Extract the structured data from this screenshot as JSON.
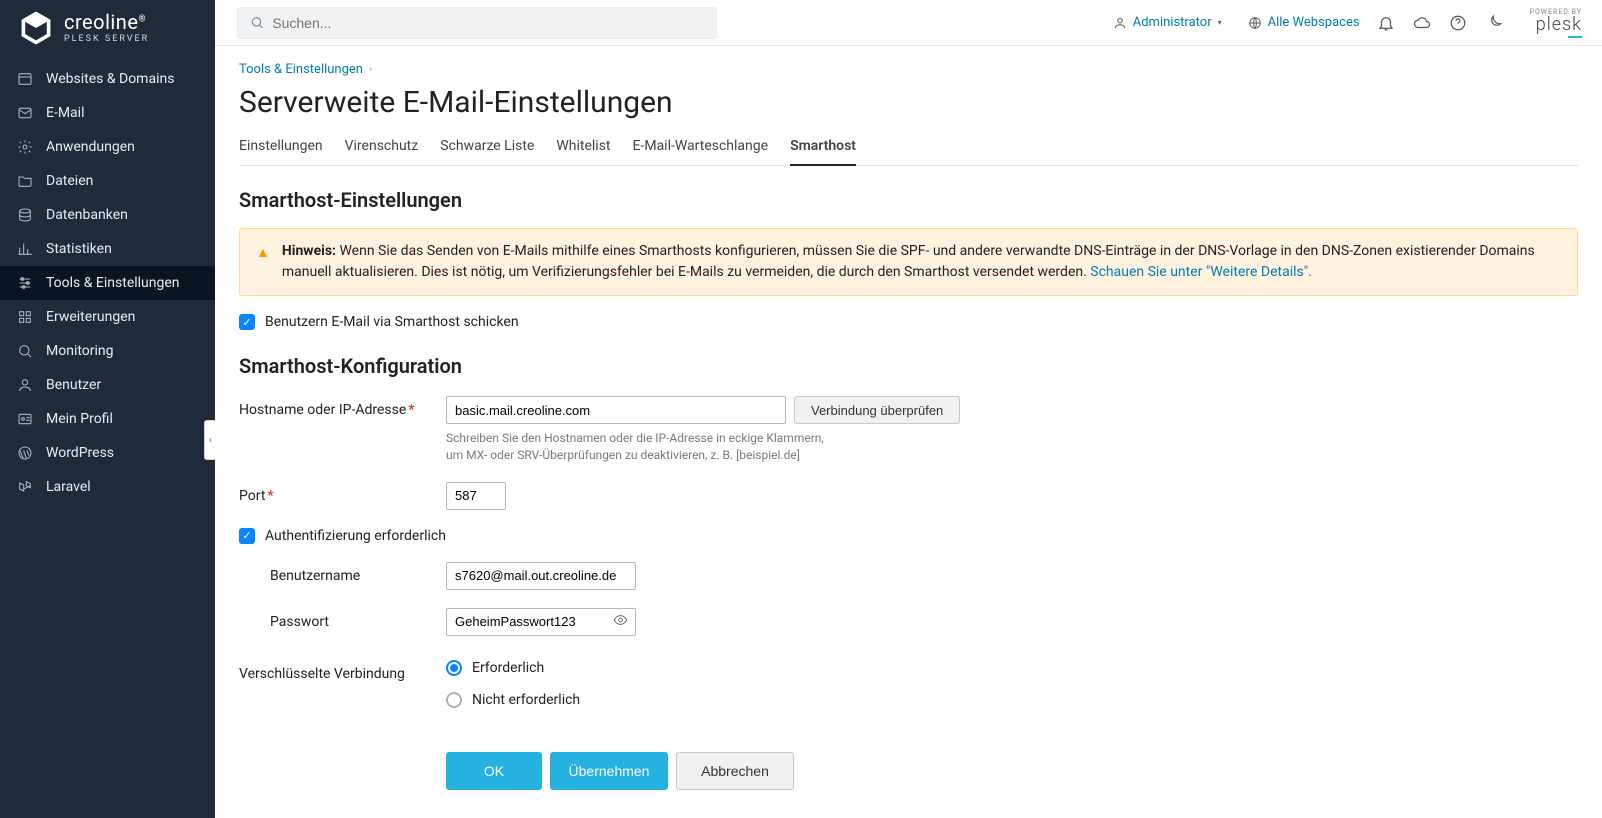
{
  "brand": {
    "name": "creoline",
    "sub": "PLESK SERVER",
    "reg": "®"
  },
  "search": {
    "placeholder": "Suchen..."
  },
  "topbar": {
    "admin": "Administrator",
    "webspaces": "Alle Webspaces"
  },
  "plesk_badge": {
    "powered": "POWERED BY",
    "name": "plesk"
  },
  "nav": {
    "websites": "Websites & Domains",
    "mail": "E-Mail",
    "apps": "Anwendungen",
    "files": "Dateien",
    "databases": "Datenbanken",
    "stats": "Statistiken",
    "tools": "Tools & Einstellungen",
    "extensions": "Erweiterungen",
    "monitoring": "Monitoring",
    "users": "Benutzer",
    "profile": "Mein Profil",
    "wordpress": "WordPress",
    "laravel": "Laravel"
  },
  "breadcrumb": {
    "root": "Tools & Einstellungen"
  },
  "page_title": "Serverweite E-Mail-Einstellungen",
  "tabs": {
    "settings": "Einstellungen",
    "antivirus": "Virenschutz",
    "blacklist": "Schwarze Liste",
    "whitelist": "Whitelist",
    "mailqueue": "E-Mail-Warteschlange",
    "smarthost": "Smarthost"
  },
  "section1_title": "Smarthost-Einstellungen",
  "notice": {
    "prefix": "Hinweis:",
    "text": " Wenn Sie das Senden von E-Mails mithilfe eines Smarthosts konfigurieren, müssen Sie die SPF- und andere verwandte DNS-Einträge in der DNS-Vorlage in den DNS-Zonen existierender Domains manuell aktualisieren. Dies ist nötig, um Verifizierungsfehler bei E-Mails zu vermeiden, die durch den Smarthost versendet werden. ",
    "link": "Schauen Sie unter \"Weitere Details\"."
  },
  "checkbox_send_via_smarthost": "Benutzern E-Mail via Smarthost schicken",
  "section2_title": "Smarthost-Konfiguration",
  "form": {
    "hostname_label": "Hostname oder IP-Adresse",
    "hostname_value": "basic.mail.creoline.com",
    "verify_btn": "Verbindung überprüfen",
    "hostname_hint1": "Schreiben Sie den Hostnamen oder die IP-Adresse in eckige Klammern,",
    "hostname_hint2": "um MX- oder SRV-Überprüfungen zu deaktivieren, z. B. [beispiel.de]",
    "port_label": "Port",
    "port_value": "587",
    "auth_required": "Authentifizierung erforderlich",
    "username_label": "Benutzername",
    "username_value": "s7620@mail.out.creoline.de",
    "password_label": "Passwort",
    "password_value": "GeheimPasswort123",
    "encryption_label": "Verschlüsselte Verbindung",
    "enc_required": "Erforderlich",
    "enc_not_required": "Nicht erforderlich"
  },
  "buttons": {
    "ok": "OK",
    "apply": "Übernehmen",
    "cancel": "Abbrechen"
  }
}
